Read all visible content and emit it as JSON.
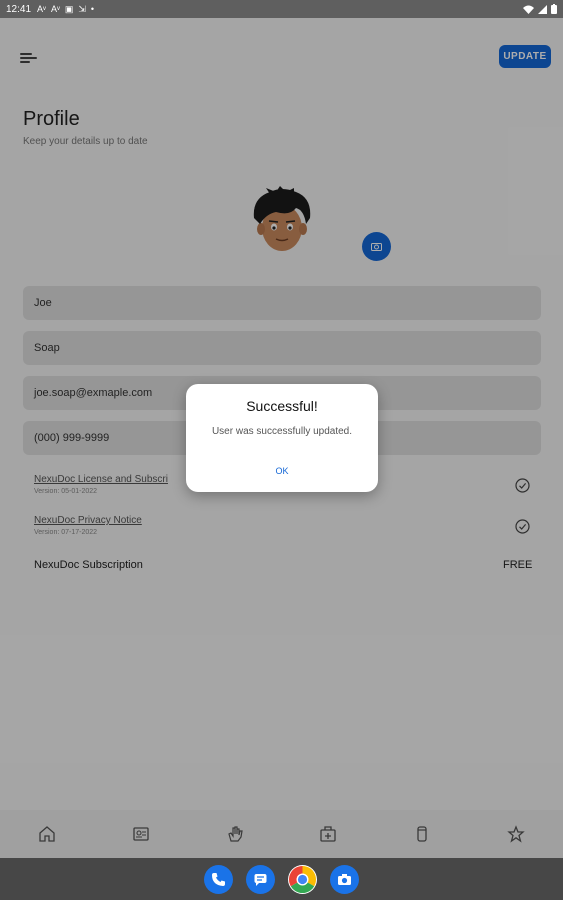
{
  "status_bar": {
    "time": "12:41",
    "notification_icons": [
      "Aᵛ",
      "Aᵛ",
      "▣",
      "⇲",
      "•"
    ]
  },
  "toolbar": {
    "menu_icon": "menu-lines-icon",
    "update_label": "UPDATE"
  },
  "profile": {
    "title": "Profile",
    "subtitle": "Keep your details up to date"
  },
  "form": {
    "first_name": "Joe",
    "last_name": "Soap",
    "email": "joe.soap@exmaple.com",
    "phone": "(000) 999-9999"
  },
  "documents": [
    {
      "title": "NexuDoc License and Subscri",
      "version": "Version: 05-01-2022",
      "icon": "check-circle-icon"
    },
    {
      "title": "NexuDoc Privacy Notice",
      "version": "Version: 07-17-2022",
      "icon": "check-circle-icon"
    }
  ],
  "subscription": {
    "label": "NexuDoc Subscription",
    "value": "FREE"
  },
  "bottom_nav": [
    "home-icon",
    "id-card-icon",
    "hand-icon",
    "medical-bag-icon",
    "tube-icon",
    "star-icon"
  ],
  "dialog": {
    "title": "Successful!",
    "message": "User was successfully updated.",
    "ok_label": "OK"
  },
  "taskbar_apps": [
    "phone-icon",
    "messages-icon",
    "chrome-icon",
    "camera-icon"
  ],
  "colors": {
    "accent": "#1467d6",
    "scrim": "rgba(0,0,0,0.32)"
  }
}
